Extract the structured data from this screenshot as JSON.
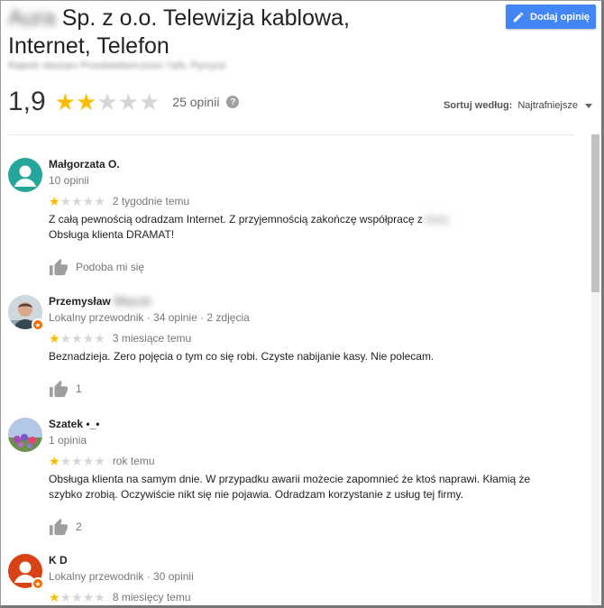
{
  "header": {
    "title_blurred": "Aura",
    "title_rest": " Sp. z o.o. Telewizja kablowa,",
    "title_line2": "Internet, Telefon",
    "address_blurred": "Rejestr obszaru Przedsiebiorczosci 7a/b, Pyrzyce",
    "add_review_label": "Dodaj opinię"
  },
  "summary": {
    "rating": "1,9",
    "rating_value": 1.9,
    "stars_filled": 2,
    "stars_total": 5,
    "review_count_label": "25 opinii",
    "help_icon": "question-icon"
  },
  "sort": {
    "label": "Sortuj według:",
    "value": "Najtrafniejsze"
  },
  "colors": {
    "star": "#fbbc04",
    "star_empty": "#d6d6d6",
    "button": "#4285f4"
  },
  "reviews": [
    {
      "name": "Małgorzata O.",
      "name_blurred": "",
      "meta": "10 opinii",
      "stars": 1,
      "date": "2 tygodnie temu",
      "text_line1": "Z całą pewnością odradzam Internet. Z przyjemnością zakończę współpracę z ",
      "text_line1_blurred": "Aura",
      "text_line2": "Obsługa klienta DRAMAT!",
      "like_label": "Podoba mi się",
      "avatar_color": "#26a69a"
    },
    {
      "name": "Przemysław",
      "name_blurred": "Więcek",
      "meta": "Lokalny przewodnik · 34 opinie · 2 zdjęcia",
      "stars": 1,
      "date": "3 miesiące temu",
      "text_line1": "Beznadzieja. Zero pojęcia o tym co się robi. Czyste nabijanie kasy. Nie polecam.",
      "like_label": "1"
    },
    {
      "name": "Szatek •_•",
      "meta": "1 opinia",
      "stars": 1,
      "date": "rok temu",
      "text_line1": "Obsługa klienta na samym dnie. W przypadku awarii możecie zapomnieć że ktoś naprawi. Kłamią że",
      "text_line2": "szybko zrobią. Oczywiście nikt się nie pojawia. Odradzam korzystanie z usług tej firmy.",
      "like_label": "2"
    },
    {
      "name": "K D",
      "meta": "Lokalny przewodnik · 30 opinii",
      "stars": 1,
      "date": "8 miesięcy temu",
      "avatar_color": "#d84315"
    }
  ]
}
